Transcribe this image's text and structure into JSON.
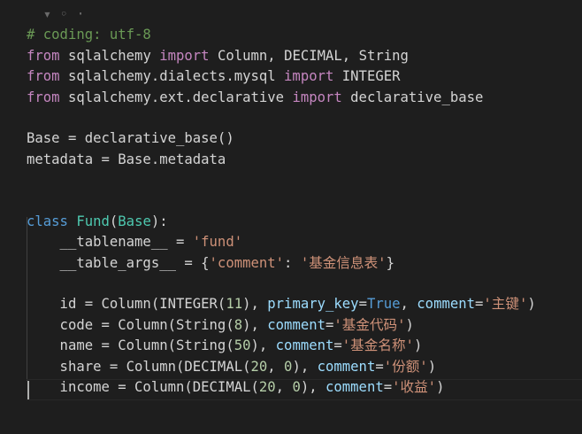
{
  "theme": {
    "background": "#1e1e1e",
    "default": "#d4d4d4",
    "comment": "#6a9955",
    "keyword": "#569cd6",
    "import_keyword": "#c586c0",
    "class_name": "#4ec9b0",
    "string": "#ce9178",
    "parameter": "#9cdcfe",
    "number": "#b5cea8"
  },
  "lines": [
    [
      {
        "c": "t-dim",
        "t": "  ▾ ◦ ·"
      }
    ],
    [
      {
        "c": "t-comment",
        "t": "# coding: utf-8"
      }
    ],
    [
      {
        "c": "t-import",
        "t": "from"
      },
      {
        "c": "t-plain",
        "t": " sqlalchemy "
      },
      {
        "c": "t-import",
        "t": "import"
      },
      {
        "c": "t-plain",
        "t": " Column, DECIMAL, String"
      }
    ],
    [
      {
        "c": "t-import",
        "t": "from"
      },
      {
        "c": "t-plain",
        "t": " sqlalchemy.dialects.mysql "
      },
      {
        "c": "t-import",
        "t": "import"
      },
      {
        "c": "t-plain",
        "t": " INTEGER"
      }
    ],
    [
      {
        "c": "t-import",
        "t": "from"
      },
      {
        "c": "t-plain",
        "t": " sqlalchemy.ext.declarative "
      },
      {
        "c": "t-import",
        "t": "import"
      },
      {
        "c": "t-plain",
        "t": " declarative_base"
      }
    ],
    [],
    [
      {
        "c": "t-plain",
        "t": "Base = declarative_base()"
      }
    ],
    [
      {
        "c": "t-plain",
        "t": "metadata = Base.metadata"
      }
    ],
    [],
    [],
    [
      {
        "c": "t-keyword",
        "t": "class"
      },
      {
        "c": "t-plain",
        "t": " "
      },
      {
        "c": "t-class",
        "t": "Fund"
      },
      {
        "c": "t-plain",
        "t": "("
      },
      {
        "c": "t-class",
        "t": "Base"
      },
      {
        "c": "t-plain",
        "t": "):"
      }
    ],
    [
      {
        "c": "t-plain",
        "t": "    __tablename__ = "
      },
      {
        "c": "t-string",
        "t": "'fund'"
      }
    ],
    [
      {
        "c": "t-plain",
        "t": "    __table_args__ = {"
      },
      {
        "c": "t-string",
        "t": "'comment'"
      },
      {
        "c": "t-plain",
        "t": ": "
      },
      {
        "c": "t-string",
        "t": "'基金信息表'"
      },
      {
        "c": "t-plain",
        "t": "}"
      }
    ],
    [],
    [
      {
        "c": "t-plain",
        "t": "    id = Column(INTEGER("
      },
      {
        "c": "t-number",
        "t": "11"
      },
      {
        "c": "t-plain",
        "t": "), "
      },
      {
        "c": "t-param",
        "t": "primary_key"
      },
      {
        "c": "t-plain",
        "t": "="
      },
      {
        "c": "t-keyword",
        "t": "True"
      },
      {
        "c": "t-plain",
        "t": ", "
      },
      {
        "c": "t-param",
        "t": "comment"
      },
      {
        "c": "t-plain",
        "t": "="
      },
      {
        "c": "t-string",
        "t": "'主键'"
      },
      {
        "c": "t-plain",
        "t": ")"
      }
    ],
    [
      {
        "c": "t-plain",
        "t": "    code = Column(String("
      },
      {
        "c": "t-number",
        "t": "8"
      },
      {
        "c": "t-plain",
        "t": "), "
      },
      {
        "c": "t-param",
        "t": "comment"
      },
      {
        "c": "t-plain",
        "t": "="
      },
      {
        "c": "t-string",
        "t": "'基金代码'"
      },
      {
        "c": "t-plain",
        "t": ")"
      }
    ],
    [
      {
        "c": "t-plain",
        "t": "    name = Column(String("
      },
      {
        "c": "t-number",
        "t": "50"
      },
      {
        "c": "t-plain",
        "t": "), "
      },
      {
        "c": "t-param",
        "t": "comment"
      },
      {
        "c": "t-plain",
        "t": "="
      },
      {
        "c": "t-string",
        "t": "'基金名称'"
      },
      {
        "c": "t-plain",
        "t": ")"
      }
    ],
    [
      {
        "c": "t-plain",
        "t": "    share = Column(DECIMAL("
      },
      {
        "c": "t-number",
        "t": "20"
      },
      {
        "c": "t-plain",
        "t": ", "
      },
      {
        "c": "t-number",
        "t": "0"
      },
      {
        "c": "t-plain",
        "t": "), "
      },
      {
        "c": "t-param",
        "t": "comment"
      },
      {
        "c": "t-plain",
        "t": "="
      },
      {
        "c": "t-string",
        "t": "'份额'"
      },
      {
        "c": "t-plain",
        "t": ")"
      }
    ],
    [
      {
        "c": "t-plain",
        "t": "    income = Column(DECIMAL("
      },
      {
        "c": "t-number",
        "t": "20"
      },
      {
        "c": "t-plain",
        "t": ", "
      },
      {
        "c": "t-number",
        "t": "0"
      },
      {
        "c": "t-plain",
        "t": "), "
      },
      {
        "c": "t-param",
        "t": "comment"
      },
      {
        "c": "t-plain",
        "t": "="
      },
      {
        "c": "t-string",
        "t": "'收益'"
      },
      {
        "c": "t-plain",
        "t": ")"
      }
    ],
    []
  ]
}
